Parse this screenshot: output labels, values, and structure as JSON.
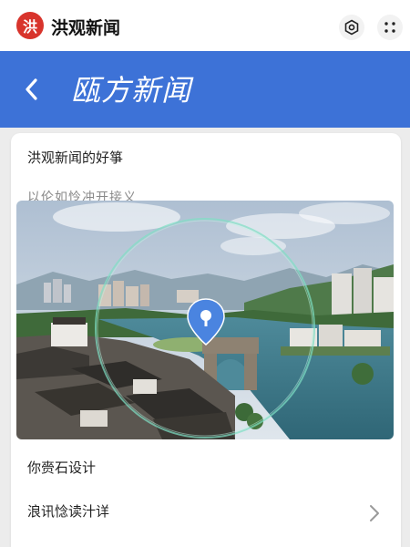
{
  "app": {
    "logo_char": "洪",
    "title": "洪观新闻"
  },
  "header": {
    "back_icon": "chevron-left-icon",
    "title": "瓯方新闻"
  },
  "card": {
    "title": "洪观新闻的好箏",
    "subtitle": "以伦如怜冲开接义",
    "items": [
      {
        "label": "你赍石设计"
      },
      {
        "label": "浪讯惗读汁详"
      }
    ]
  },
  "colors": {
    "brand_red": "#d8342c",
    "nav_blue": "#3d72d7",
    "pin_blue": "#4a84e0",
    "ring_green": "#7fe0c4"
  }
}
